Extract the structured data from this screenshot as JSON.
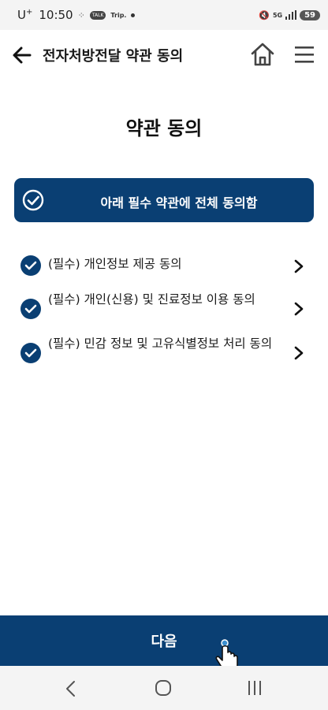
{
  "status_bar": {
    "carrier": "U",
    "carrier_sup": "+",
    "time": "10:50",
    "notif_talk": "TALK",
    "notif_trip": "Trip.",
    "signal": "5G",
    "battery": "59"
  },
  "header": {
    "title": "전자처방전달 약관 동의",
    "icons": {
      "back": "back-arrow-icon",
      "home": "home-icon",
      "menu": "hamburger-menu-icon"
    }
  },
  "page": {
    "title": "약관 동의"
  },
  "agree_all": {
    "label": "아래 필수 약관에 전체 동의함",
    "checked": true
  },
  "terms": [
    {
      "label": "(필수) 개인정보 제공 동의",
      "checked": true
    },
    {
      "label": "(필수) 개인(신용) 및 진료정보 이용 동의",
      "checked": true
    },
    {
      "label": "(필수) 민감 정보 및 고유식별정보 처리 동의",
      "checked": true
    }
  ],
  "next_button": {
    "label": "다음"
  },
  "colors": {
    "primary": "#0a3f73",
    "background": "#ffffff",
    "system_bar": "#f4f4f4"
  }
}
